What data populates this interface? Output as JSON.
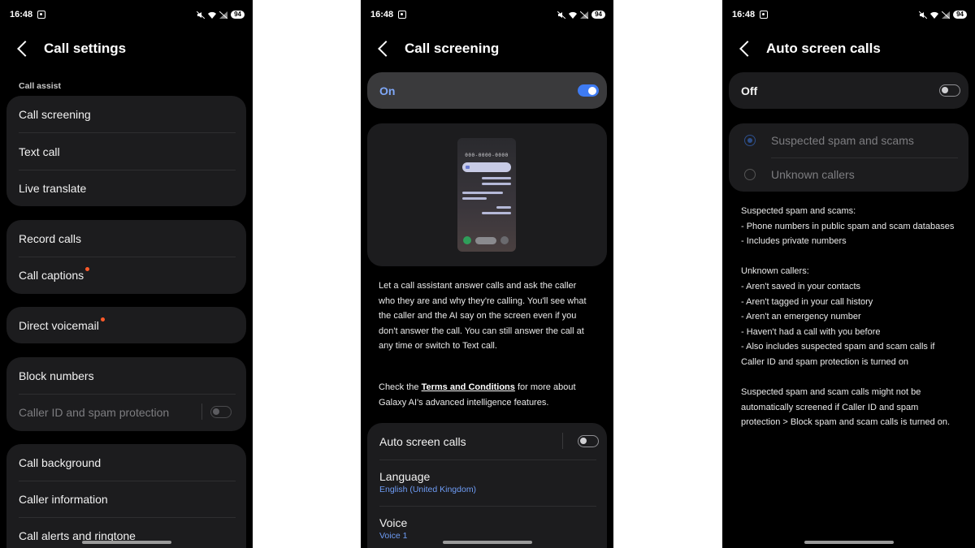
{
  "status": {
    "time": "16:48",
    "battery": "94"
  },
  "screen1": {
    "title": "Call settings",
    "section": "Call assist",
    "group1": [
      "Call screening",
      "Text call",
      "Live translate"
    ],
    "group2": [
      "Record calls",
      "Call captions"
    ],
    "group3": [
      "Direct voicemail"
    ],
    "group4": {
      "block": "Block numbers",
      "callerid": "Caller ID and spam protection",
      "callerid_toggle": "off"
    },
    "group5": [
      "Call background",
      "Caller information",
      "Call alerts and ringtone"
    ]
  },
  "screen2": {
    "title": "Call screening",
    "master_label": "On",
    "master_toggle": "on",
    "illustration": {
      "number": "000-0000-0000"
    },
    "description": "Let a call assistant answer calls and ask the caller who they are and why they're calling. You'll see what the caller and the AI say on the screen even if you don't answer the call. You can still answer the call at any time or switch to Text call.",
    "terms_prefix": "Check the ",
    "terms_link": "Terms and Conditions",
    "terms_suffix": " for more about Galaxy AI's advanced intelligence features.",
    "auto_label": "Auto screen calls",
    "auto_toggle": "off",
    "language_label": "Language",
    "language_value": "English (United Kingdom)",
    "voice_label": "Voice",
    "voice_value": "Voice 1"
  },
  "screen3": {
    "title": "Auto screen calls",
    "master_label": "Off",
    "master_toggle": "off",
    "options": [
      "Suspected spam and scams",
      "Unknown callers"
    ],
    "selected_option": "Suspected spam and scams",
    "info1": [
      "Suspected spam and scams:",
      "- Phone numbers in public spam and scam databases",
      "- Includes private numbers"
    ],
    "info2": [
      "Unknown callers:",
      "- Aren't saved in your contacts",
      "- Aren't tagged in your call history",
      "- Aren't an emergency number",
      "- Haven't had a call with you before",
      "- Also includes suspected spam and scam calls if Caller ID and spam protection is turned on"
    ],
    "info3": "Suspected spam and scam calls might not be automatically screened if Caller ID and spam protection > Block spam and scam calls is turned on."
  }
}
